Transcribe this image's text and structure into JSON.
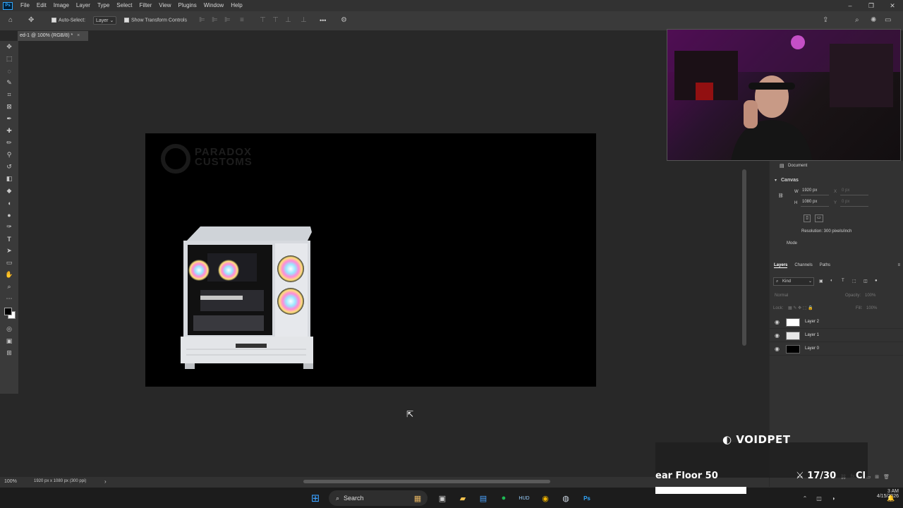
{
  "menubar": {
    "items": [
      "File",
      "Edit",
      "Image",
      "Layer",
      "Type",
      "Select",
      "Filter",
      "View",
      "Plugins",
      "Window",
      "Help"
    ],
    "logo": "Ps"
  },
  "options": {
    "auto_select_label": "Auto-Select:",
    "auto_select_value": "Layer",
    "transform_label": "Show Transform Controls",
    "more": "•••"
  },
  "document": {
    "tab_title": "ed-1 @ 100% (RGB/8) *",
    "close": "×"
  },
  "canvas": {
    "logo_line1": "PARADOX",
    "logo_line2": "CUSTOMS"
  },
  "status": {
    "zoom": "100%",
    "info": "1920 px x 1080 px (300 ppi)",
    "arrow": "›"
  },
  "properties": {
    "section_document": "Document",
    "section_canvas": "Canvas",
    "w_label": "W",
    "w_value": "1920 px",
    "h_label": "H",
    "h_value": "1080 px",
    "x_label": "X",
    "x_value": "0 px",
    "y_label": "Y",
    "y_value": "0 px",
    "resolution": "Resolution: 300 pixels/inch",
    "mode": "Mode"
  },
  "layers_panel": {
    "tabs": [
      "Layers",
      "Channels",
      "Paths"
    ],
    "kind": "Kind",
    "blend": "Normal",
    "opacity_label": "Opacity:",
    "opacity_value": "100%",
    "lock_label": "Lock:",
    "fill_label": "Fill:",
    "fill_value": "100%",
    "layers": [
      {
        "name": "Layer 2",
        "thumb_color": "#ffffff"
      },
      {
        "name": "Layer 1",
        "thumb_color": "#e8e8e8"
      },
      {
        "name": "Layer 0",
        "thumb_color": "#000000"
      }
    ]
  },
  "overlay": {
    "brand": "VOIDPET",
    "floor": "ear Floor 50",
    "count": "17/30",
    "cl": "Cl",
    "progress_fraction": 0.43
  },
  "taskbar": {
    "search": "Search",
    "time": "3 AM",
    "date": "4/15/2026"
  },
  "colors": {
    "ps_blue": "#31a8ff",
    "canvas": "#000000",
    "workspace": "#282828"
  }
}
